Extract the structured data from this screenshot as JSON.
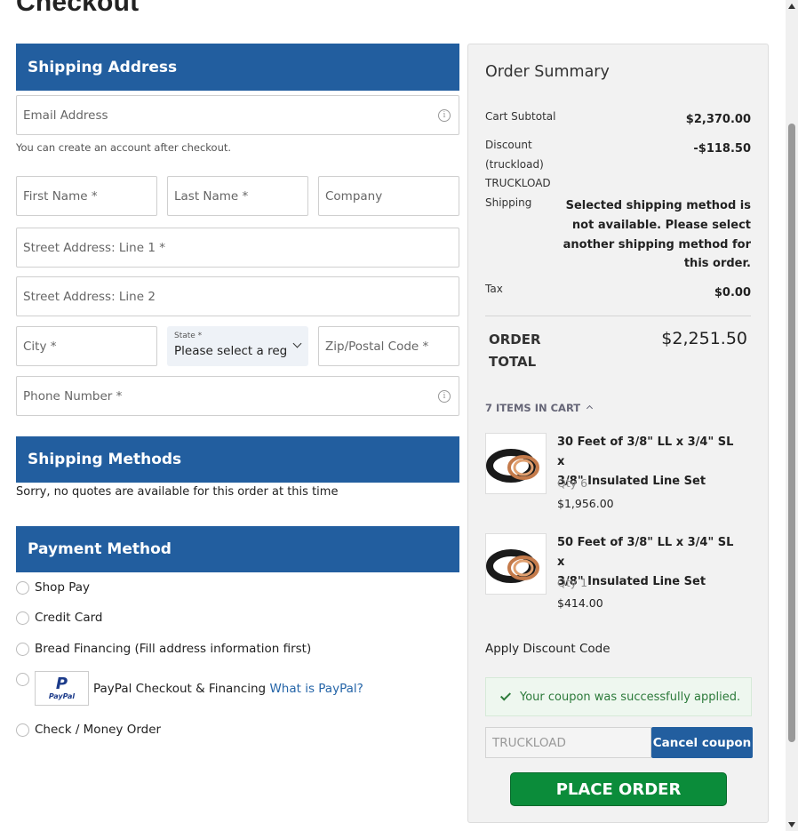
{
  "page": {
    "title": "Checkout"
  },
  "shipping_address": {
    "header": "Shipping Address",
    "email_placeholder": "Email Address",
    "email_helper": "You can create an account after checkout.",
    "first_name_placeholder": "First Name *",
    "last_name_placeholder": "Last Name *",
    "company_placeholder": "Company",
    "street1_placeholder": "Street Address: Line 1 *",
    "street2_placeholder": "Street Address: Line 2",
    "city_placeholder": "City *",
    "state_label": "State *",
    "state_value": "Please select a region",
    "zip_placeholder": "Zip/Postal Code *",
    "phone_placeholder": "Phone Number *",
    "info_glyph": "i"
  },
  "shipping_methods": {
    "header": "Shipping Methods",
    "message": "Sorry, no quotes are available for this order at this time"
  },
  "payment_method": {
    "header": "Payment Method",
    "options": [
      {
        "label": "Shop Pay"
      },
      {
        "label": "Credit Card"
      },
      {
        "label": "Bread Financing (Fill address information first)"
      },
      {
        "label": "PayPal Checkout & Financing",
        "link": "What is PayPal?"
      },
      {
        "label": "Check / Money Order"
      }
    ],
    "paypal_logo_text": "PayPal",
    "paypal_logo_glyph": "P"
  },
  "order_summary": {
    "title": "Order Summary",
    "cart_subtotal_label": "Cart Subtotal",
    "cart_subtotal_value": "$2,370.00",
    "discount_label_1": "Discount",
    "discount_label_2": "(truckload)",
    "discount_label_3": "TRUCKLOAD",
    "discount_value": "-$118.50",
    "shipping_label": "Shipping",
    "shipping_message_lines": [
      "Selected shipping method is",
      "not available. Please select",
      "another shipping method for",
      "this order."
    ],
    "tax_label": "Tax",
    "tax_value": "$0.00",
    "order_total_label_1": "ORDER",
    "order_total_label_2": "TOTAL",
    "order_total_value": "$2,251.50",
    "items_toggle": "7 ITEMS IN CART",
    "items": [
      {
        "name_line1": "30 Feet of 3/8\" LL x 3/4\" SL x",
        "name_line2": "3/8\" Insulated Line Set",
        "qty": "Qty 6",
        "price": "$1,956.00"
      },
      {
        "name_line1": "50 Feet of 3/8\" LL x 3/4\" SL x",
        "name_line2": "3/8\" Insulated Line Set",
        "qty": "Qty 1",
        "price": "$414.00"
      }
    ],
    "apply_discount_label": "Apply Discount Code",
    "success_message": "Your coupon was successfully applied.",
    "coupon_value": "TRUCKLOAD",
    "cancel_coupon_label": "Cancel coupon",
    "place_order_label": "PLACE ORDER"
  },
  "colors": {
    "header_blue": "#225e9f",
    "place_order_green": "#0b8c3a",
    "success_green": "#2c7a3a",
    "link_blue": "#2565a8"
  }
}
